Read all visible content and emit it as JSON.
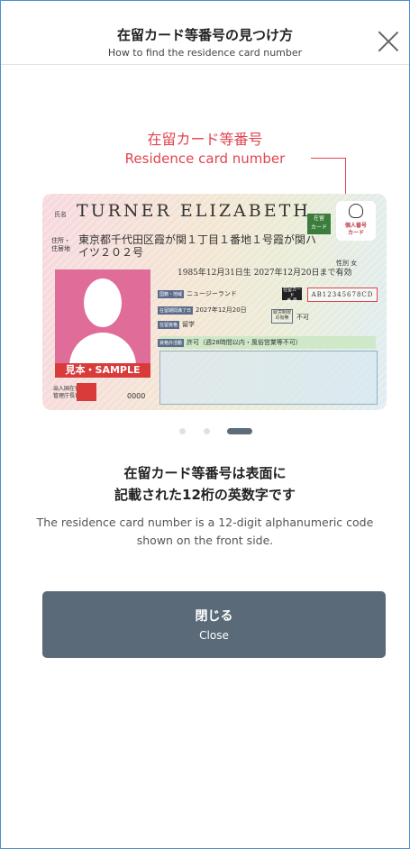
{
  "header": {
    "title": "在留カード等番号の見つけ方",
    "subtitle": "How to find the residence card number",
    "close_icon": "close-icon"
  },
  "callout": {
    "label_ja": "在留カード等番号",
    "label_en": "Residence card number"
  },
  "card": {
    "name_label": "氏名",
    "name": "TURNER ELIZABETH",
    "status_badge": "在留\nカード",
    "mynumber_label": "個人番号\nカード",
    "address_label": "住所・\n住居地",
    "address_line1": "東京都千代田区霞が関１丁目１番地１号霞が関ハ",
    "address_line2": "イツ２０２号",
    "gender": "性別 女",
    "dates": "1985年12月31日生  2027年12月20日まで有効",
    "nationality_tag": "国籍・地域",
    "nationality": "ニュージーランド",
    "card_number_tag": "在留カード\n番 号",
    "card_number": "AB12345678CD",
    "period_tag": "在留期間満了日",
    "period": "2027年12月20日",
    "permission_tag": "就労制限\nの有無",
    "permission": "不可",
    "status_tag": "在留資格",
    "status": "留学",
    "activity_tag": "資格外活動",
    "activity": "許可（週28時間以内・風俗営業等不可）",
    "sample_label": "見本・SAMPLE",
    "issuer": "出入国在留\n管理庁長官",
    "serial": "0000"
  },
  "carousel": {
    "total": 3,
    "active_index": 2
  },
  "description": {
    "ja_line1": "在留カード等番号は表面に",
    "ja_line2": "記載された12桁の英数字です",
    "en": "The residence card number is a 12-digit alphanumeric code shown on the front side."
  },
  "close_button": {
    "label_ja": "閉じる",
    "label_en": "Close"
  },
  "colors": {
    "accent_red": "#e0454e",
    "button_bg": "#5a6a78",
    "dot_active": "#5c6c7b",
    "dot_inactive": "#dde2e8"
  }
}
